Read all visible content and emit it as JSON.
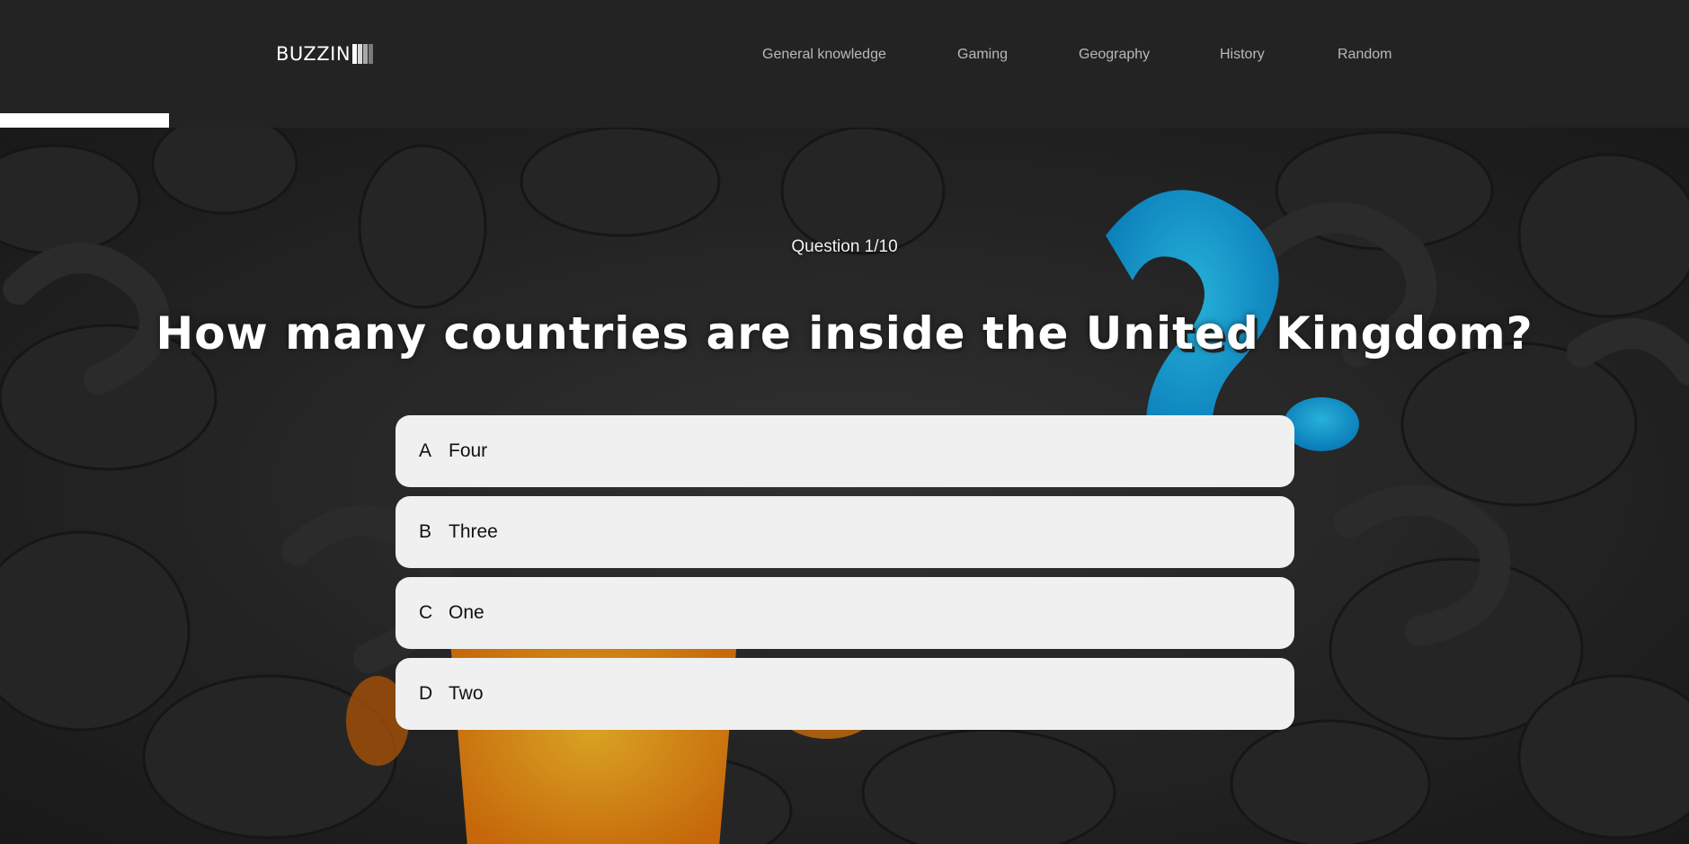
{
  "header": {
    "logo_text": "BUZZIN",
    "logo_bar_colors": [
      "#ffffff",
      "#d9d9d9",
      "#a8a8a8",
      "#7a7a7a"
    ],
    "nav": [
      {
        "label": "General knowledge"
      },
      {
        "label": "Gaming"
      },
      {
        "label": "Geography"
      },
      {
        "label": "History"
      },
      {
        "label": "Random"
      }
    ],
    "progress_fraction": 0.1
  },
  "quiz": {
    "counter": "Question 1/10",
    "question": "How many countries are inside the United Kingdom?",
    "answers": [
      {
        "letter": "A",
        "text": "Four"
      },
      {
        "letter": "B",
        "text": "Three"
      },
      {
        "letter": "C",
        "text": "One"
      },
      {
        "letter": "D",
        "text": "Two"
      }
    ]
  },
  "colors": {
    "header_bg": "#232323",
    "answer_bg": "#f0f0f0",
    "accent_blue": "#13c0ff",
    "accent_orange": "#ffa317"
  }
}
